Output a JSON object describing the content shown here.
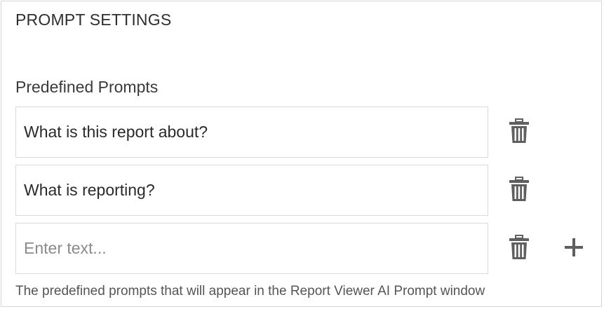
{
  "section": {
    "title": "PROMPT SETTINGS"
  },
  "predefined_prompts": {
    "label": "Predefined Prompts",
    "items": [
      {
        "value": "What is this report about?",
        "placeholder": "Enter text..."
      },
      {
        "value": "What is reporting?",
        "placeholder": "Enter text..."
      },
      {
        "value": "",
        "placeholder": "Enter text..."
      }
    ],
    "help_text": "The predefined prompts that will appear in the Report Viewer AI Prompt window"
  },
  "icons": {
    "delete": "trash-icon",
    "add": "plus-icon"
  },
  "colors": {
    "icon": "#5f5f5f",
    "border": "#d9d9d9",
    "panel_border": "#d6d6d6"
  }
}
